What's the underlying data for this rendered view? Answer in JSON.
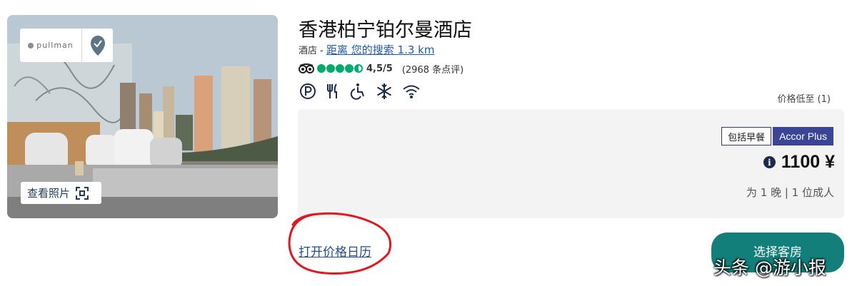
{
  "photo": {
    "logo_text": "pullman",
    "view_photos_label": "查看照片",
    "fullscreen_icon": "fullscreen-icon",
    "badge_icon": "all-safe-badge"
  },
  "hotel": {
    "name": "香港柏宁铂尔曼酒店",
    "type": "酒店",
    "separator": " - ",
    "distance_link": "距离 您的搜索 1.3 km",
    "rating_score": "4,5/5",
    "review_count": "(2968 条点评)",
    "amenity_icons": [
      "parking-icon",
      "restaurant-icon",
      "accessibility-icon",
      "air-conditioning-icon",
      "wifi-icon"
    ]
  },
  "pricing": {
    "low_price_label": "价格低至 (1)",
    "breakfast_tag": "包括早餐",
    "accor_tag": "Accor Plus",
    "price": "1100 ¥",
    "per_label": "为 1 晚 | 1 位成人"
  },
  "actions": {
    "calendar_link": "打开价格日历",
    "select_room": "选择客房"
  },
  "watermark": "头条 @游小报",
  "colors": {
    "accent_teal": "#127f7a",
    "accor_blue": "#3b4596",
    "link_blue": "#1f5aa6",
    "annotation_red": "#e0191e",
    "tripadvisor_green": "#00aa6c"
  }
}
